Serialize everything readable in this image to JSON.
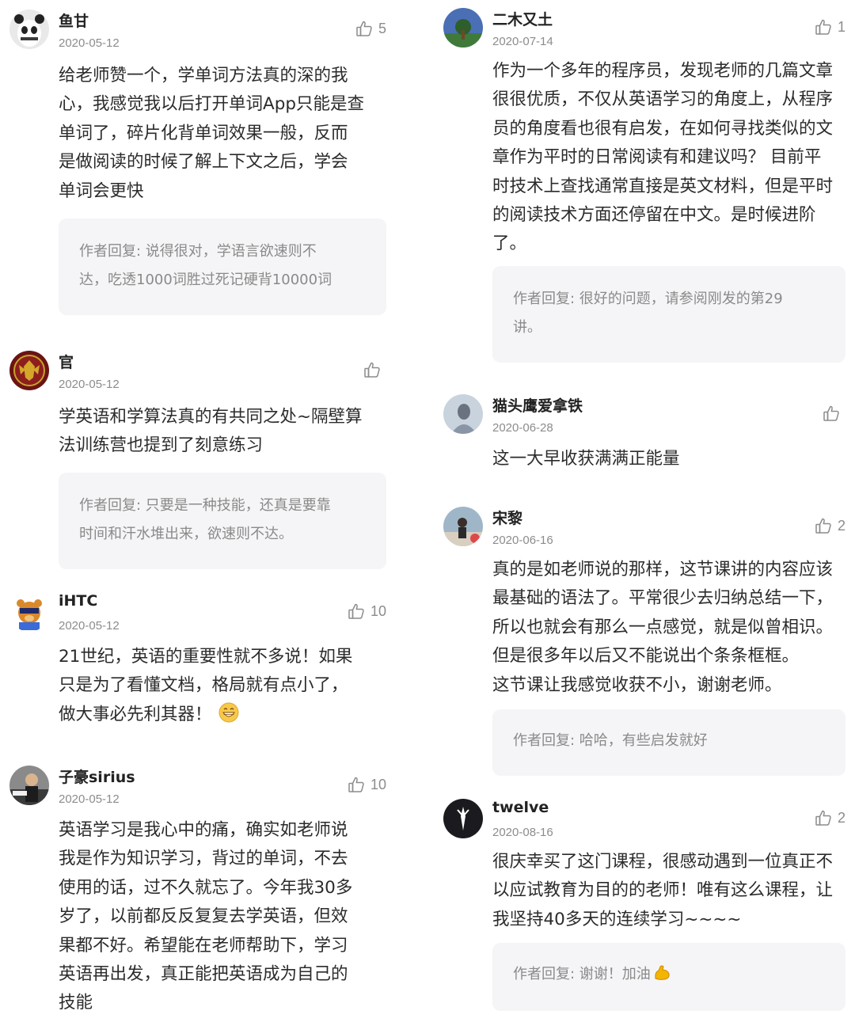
{
  "comments": [
    {
      "name": "鱼甘",
      "date": "2020-05-12",
      "likes": "5",
      "lines": [
        "给老师赞一个，学单词方法真的深的我",
        "心，我感觉我以后打开单词App只能是查",
        "单词了，碎片化背单词效果一般，反而",
        "是做阅读的时候了解上下文之后，学会",
        "单词会更快"
      ],
      "reply_lines": [
        "作者回复: 说得很对，学语言欲速则不",
        "达，吃透1000词胜过死记硬背10000词"
      ]
    },
    {
      "name": "官",
      "date": "2020-05-12",
      "likes": "",
      "lines": [
        "学英语和学算法真的有共同之处~隔壁算",
        "法训练营也提到了刻意练习"
      ],
      "reply_lines": [
        "作者回复: 只要是一种技能，还真是要靠",
        "时间和汗水堆出来，欲速则不达。"
      ]
    },
    {
      "name": "iHTC",
      "date": "2020-05-12",
      "likes": "10",
      "lines": [
        "21世纪，英语的重要性就不多说！如果",
        "只是为了看懂文档，格局就有点小了，",
        "做大事必先利其器！"
      ],
      "emoji": "grinning-emoji"
    },
    {
      "name": "子豪sirius",
      "date": "2020-05-12",
      "likes": "10",
      "lines": [
        "英语学习是我心中的痛，确实如老师说",
        "我是作为知识学习，背过的单词，不去",
        "使用的话，过不久就忘了。今年我30多",
        "岁了，以前都反反复复去学英语，但效",
        "果都不好。希望能在老师帮助下，学习",
        "英语再出发，真正能把英语成为自己的",
        "技能"
      ]
    },
    {
      "name": "二木又土",
      "date": "2020-07-14",
      "likes": "1",
      "lines": [
        "作为一个多年的程序员，发现老师的几篇文章",
        "很很优质，不仅从英语学习的角度上，从程序",
        "员的角度看也很有启发，在如何寻找类似的文",
        "章作为平时的日常阅读有和建议吗？ 目前平",
        "时技术上查找通常直接是英文材料，但是平时",
        "的阅读技术方面还停留在中文。是时候进阶",
        "了。"
      ],
      "reply_lines": [
        "作者回复: 很好的问题，请参阅刚发的第29",
        "讲。"
      ]
    },
    {
      "name": "猫头鹰爱拿铁",
      "date": "2020-06-28",
      "likes": "",
      "lines": [
        "这一大早收获满满正能量"
      ]
    },
    {
      "name": "宋黎",
      "date": "2020-06-16",
      "likes": "2",
      "lines": [
        "真的是如老师说的那样，这节课讲的内容应该",
        "最基础的语法了。平常很少去归纳总结一下，",
        "所以也就会有那么一点感觉，就是似曾相识。",
        "但是很多年以后又不能说出个条条框框。",
        "这节课让我感觉收获不小，谢谢老师。"
      ],
      "reply_lines": [
        "作者回复: 哈哈，有些启发就好"
      ]
    },
    {
      "name": "twelve",
      "date": "2020-08-16",
      "likes": "2",
      "lines": [
        "很庆幸买了这门课程，很感动遇到一位真正不",
        "以应试教育为目的的老师！唯有这么课程，让",
        "我坚持40多天的连续学习~~~~"
      ],
      "reply_lines": [
        "作者回复: 谢谢！加油"
      ],
      "reply_emoji": "flexed-biceps-emoji"
    }
  ]
}
